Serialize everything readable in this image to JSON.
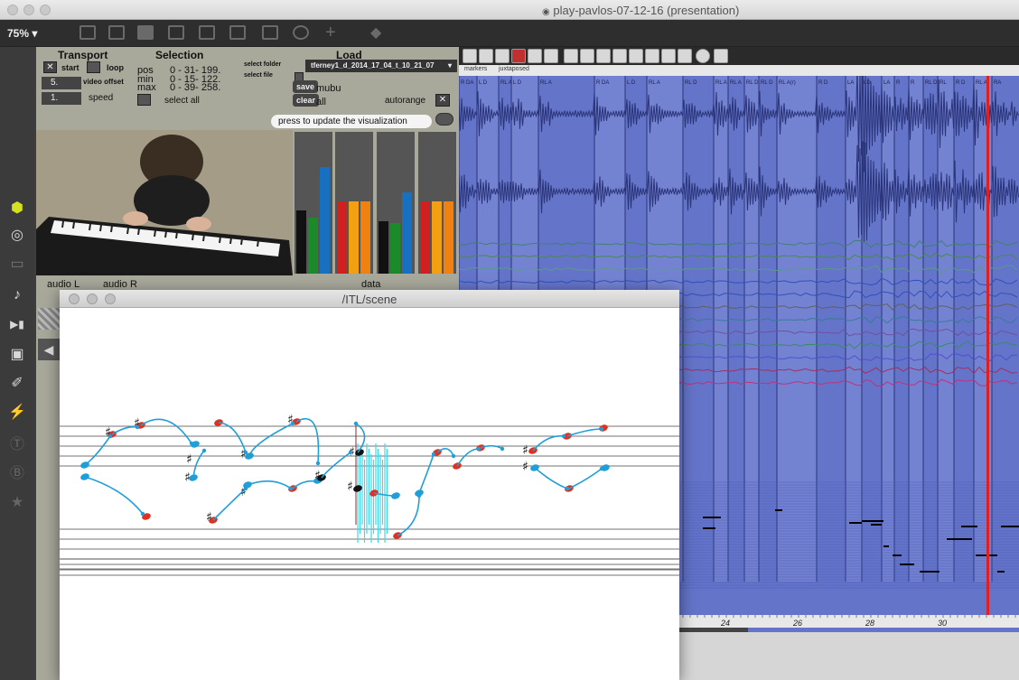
{
  "window": {
    "title": "play-pavlos-07-12-16 (presentation)"
  },
  "toolbar": {
    "zoom": "75% ▾"
  },
  "sidebar": {
    "icons": [
      "cube-icon",
      "target-icon",
      "strip-icon",
      "music-note-icon",
      "step-forward-icon",
      "image-icon",
      "paperclip-icon",
      "plug-icon",
      "v-icon",
      "b-icon",
      "star-icon"
    ]
  },
  "transport": {
    "header": "Transport",
    "start_label": "start",
    "loop_label": "loop",
    "video_offset_value": "5.",
    "video_offset_label": "video offset",
    "speed_value": "1.",
    "speed_label": "speed"
  },
  "selection": {
    "header": "Selection",
    "pos_label": "pos",
    "pos_values": "0  - 31- 199.",
    "min_label": "min",
    "min_values": "0  - 15- 122.",
    "max_label": "max",
    "max_values": "0  - 39- 258.",
    "select_all": "select all"
  },
  "load": {
    "header": "Load",
    "select_folder": "select folder",
    "select_file": "select file",
    "file_value": "tferney1_d_2014_17_04_t_10_21_07",
    "save_button": "save",
    "save_target": "mubu",
    "clear_button": "clear",
    "clear_target": "all",
    "autorange_label": "autorange",
    "update_message": "press to update the visualization"
  },
  "bottom_labels": {
    "audio_l": "audio L",
    "audio_r": "audio R",
    "data": "data"
  },
  "viz": {
    "tabs": [
      "markers",
      "juxtaposed"
    ],
    "ticks": [
      "24",
      "26",
      "28",
      "30"
    ],
    "marker_labels": [
      "R DA",
      "L D",
      "RL A",
      "L D",
      "RL A",
      "R DA",
      "L D",
      "RL A",
      "RL D",
      "RL A",
      "RL A",
      "RL D",
      "RL D",
      "RL A(r)",
      "R D",
      "LA",
      "LD",
      "LA",
      "R",
      "R",
      "RL D",
      "RL",
      "R D",
      "RL A",
      "RA"
    ],
    "colors": {
      "background": "#6474c8",
      "cursor": "#e02020",
      "waveform": "#2a3478"
    }
  },
  "scene": {
    "title": "/ITL/scene"
  },
  "colors": {
    "accent_blue": "#1f9fd8",
    "note_red": "#e03020",
    "panel": "#a8a89b"
  }
}
